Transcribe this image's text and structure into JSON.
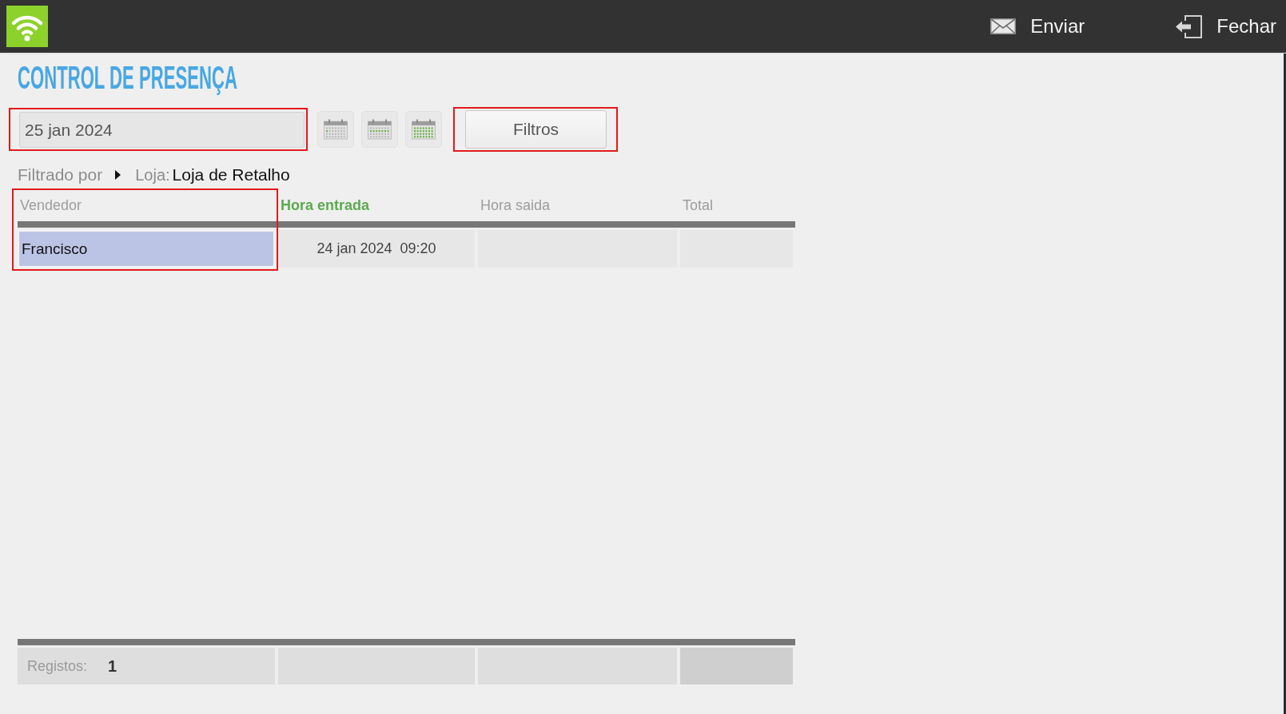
{
  "top_bar": {
    "actions": [
      {
        "kind": "send",
        "label": "Enviar"
      },
      {
        "kind": "close",
        "label": "Fechar"
      }
    ]
  },
  "title": "CONTROL DE PRESENÇA",
  "date_field": {
    "value": "25 jan 2024",
    "highlighted": true
  },
  "period_buttons": [
    {
      "kind": "day"
    },
    {
      "kind": "week"
    },
    {
      "kind": "month"
    }
  ],
  "filter_button": {
    "label": "Filtros",
    "highlighted": true
  },
  "filter_summary": {
    "label": "Filtrado por",
    "field": "Loja:",
    "value": "Loja de Retalho"
  },
  "table": {
    "columns": [
      {
        "label": "Vendedor",
        "sorted": false,
        "highlighted": true
      },
      {
        "label": "Hora entrada",
        "sorted": true,
        "highlighted": false
      },
      {
        "label": "Hora saida",
        "sorted": false,
        "highlighted": false
      },
      {
        "label": "Total",
        "sorted": false,
        "highlighted": false
      }
    ],
    "rows": [
      {
        "cells": [
          "Francisco",
          "24 jan 2024  09:20"
        ],
        "selected": true
      }
    ],
    "footer": {
      "label": "Registos:",
      "count": "1"
    }
  }
}
